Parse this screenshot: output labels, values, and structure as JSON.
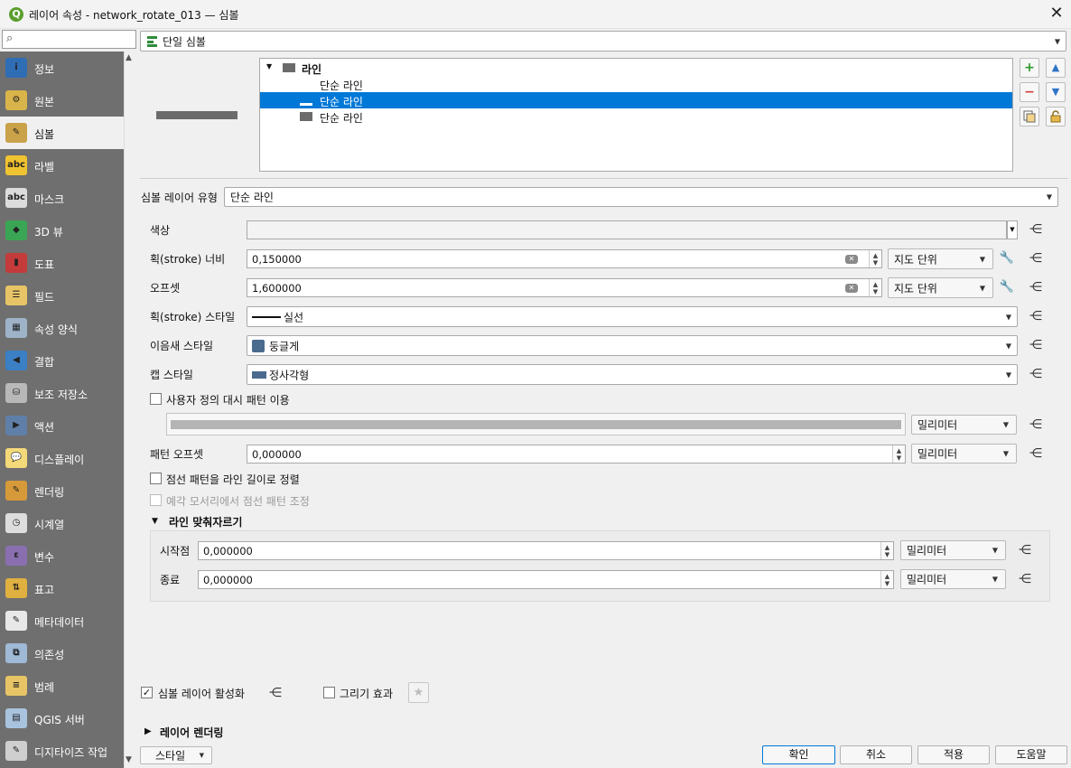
{
  "window": {
    "title": "레이어 속성 - network_rotate_013 — 심볼",
    "app_icon": "qgis-icon",
    "close_label": "✕"
  },
  "search": {
    "placeholder": ""
  },
  "sidebar": {
    "items": [
      {
        "label": "정보",
        "icon": "info-icon"
      },
      {
        "label": "원본",
        "icon": "source-icon"
      },
      {
        "label": "심볼",
        "icon": "symbology-icon",
        "active": true
      },
      {
        "label": "라벨",
        "icon": "labels-icon"
      },
      {
        "label": "마스크",
        "icon": "mask-icon"
      },
      {
        "label": "3D 뷰",
        "icon": "3d-view-icon"
      },
      {
        "label": "도표",
        "icon": "diagrams-icon"
      },
      {
        "label": "필드",
        "icon": "fields-icon"
      },
      {
        "label": "속성 양식",
        "icon": "attributes-form-icon"
      },
      {
        "label": "결합",
        "icon": "joins-icon"
      },
      {
        "label": "보조 저장소",
        "icon": "auxiliary-storage-icon"
      },
      {
        "label": "액션",
        "icon": "actions-icon"
      },
      {
        "label": "디스플레이",
        "icon": "display-icon"
      },
      {
        "label": "렌더링",
        "icon": "rendering-icon"
      },
      {
        "label": "시계열",
        "icon": "temporal-icon"
      },
      {
        "label": "변수",
        "icon": "variables-icon"
      },
      {
        "label": "표고",
        "icon": "elevation-icon"
      },
      {
        "label": "메타데이터",
        "icon": "metadata-icon"
      },
      {
        "label": "의존성",
        "icon": "dependencies-icon"
      },
      {
        "label": "범례",
        "icon": "legend-icon"
      },
      {
        "label": "QGIS 서버",
        "icon": "qgis-server-icon"
      },
      {
        "label": "디지타이즈 작업",
        "icon": "digitizing-icon"
      }
    ]
  },
  "renderer": {
    "value": "단일 심볼",
    "icon": "single-symbol-icon"
  },
  "symbol_tree": {
    "root": "라인",
    "layers": [
      "단순 라인",
      "단순 라인",
      "단순 라인"
    ],
    "selected_index": 1
  },
  "tree_buttons": {
    "add": "+",
    "remove": "−",
    "up": "▲",
    "down": "▼"
  },
  "symbol_layer_type": {
    "label": "심볼 레이어 유형",
    "value": "단순 라인"
  },
  "props": {
    "color_label": "색상",
    "stroke_width_label": "획(stroke) 너비",
    "stroke_width_value": "0,150000",
    "stroke_width_unit": "지도 단위",
    "offset_label": "오프셋",
    "offset_value": "1,600000",
    "offset_unit": "지도 단위",
    "stroke_style_label": "획(stroke) 스타일",
    "stroke_style_value": "실선",
    "join_style_label": "이음새 스타일",
    "join_style_value": "둥글게",
    "cap_style_label": "캡 스타일",
    "cap_style_value": "정사각형",
    "custom_dash_label": "사용자 정의 대시 패턴 이용",
    "dash_unit": "밀리미터",
    "pattern_offset_label": "패턴 오프셋",
    "pattern_offset_value": "0,000000",
    "pattern_offset_unit": "밀리미터",
    "align_dash_label": "점선 패턴을 라인 길이로 정렬",
    "tweak_dash_label": "예각 모서리에서 점선 패턴 조정"
  },
  "trim": {
    "title": "라인 맞춰자르기",
    "start_label": "시작점",
    "start_value": "0,000000",
    "start_unit": "밀리미터",
    "end_label": "종료",
    "end_value": "0,000000",
    "end_unit": "밀리미터"
  },
  "bottom": {
    "enable_layer_label": "심볼 레이어 활성화",
    "enable_layer_checked": true,
    "draw_effects_label": "그리기 효과",
    "draw_effects_checked": false,
    "layer_rendering_label": "레이어 렌더링"
  },
  "footer": {
    "style_label": "스타일",
    "ok_label": "확인",
    "cancel_label": "취소",
    "apply_label": "적용",
    "help_label": "도움말"
  }
}
